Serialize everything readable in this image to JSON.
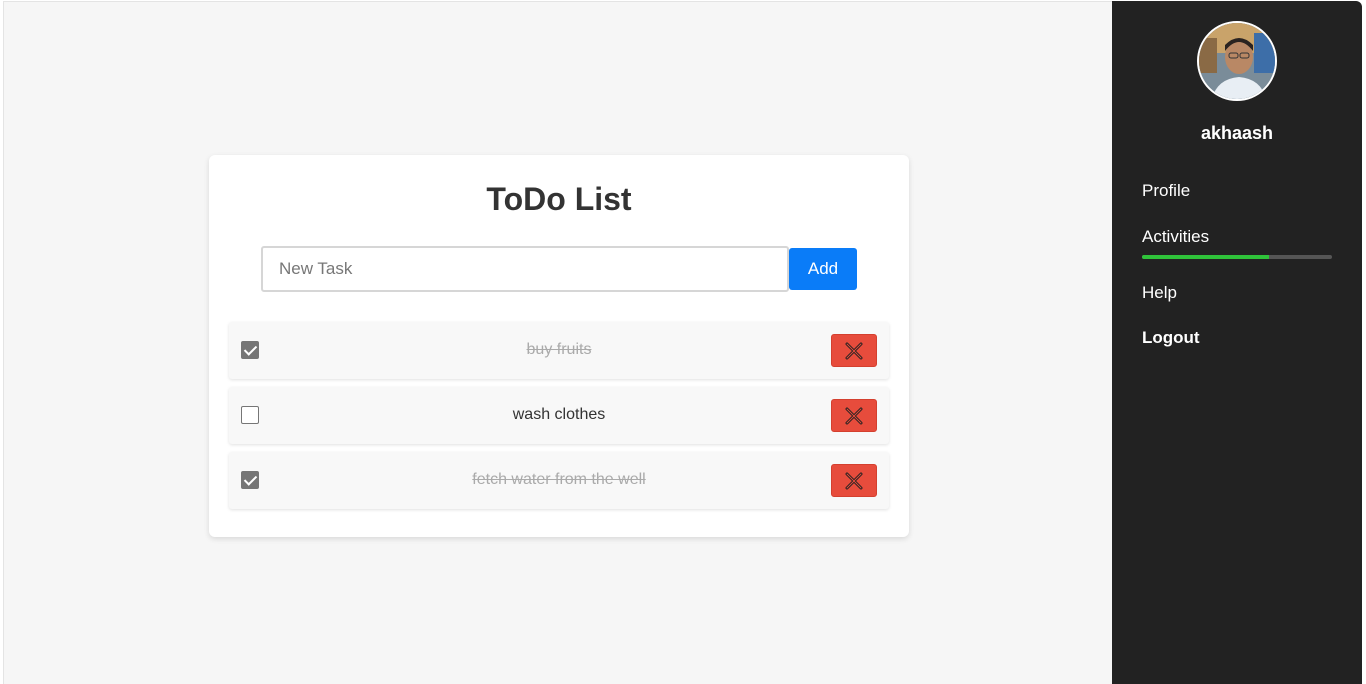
{
  "todo": {
    "title": "ToDo List",
    "input_placeholder": "New Task",
    "input_value": "",
    "add_label": "Add",
    "tasks": [
      {
        "text": "buy fruits",
        "done": true
      },
      {
        "text": "wash clothes",
        "done": false
      },
      {
        "text": "fetch water from the well",
        "done": true
      }
    ]
  },
  "sidebar": {
    "username": "akhaash",
    "nav": {
      "profile": "Profile",
      "activities": "Activities",
      "help": "Help",
      "logout": "Logout"
    },
    "activities_progress": 0.67
  },
  "colors": {
    "add_button": "#0a7cf8",
    "delete_button": "#e74c3c",
    "sidebar_bg": "#222222",
    "progress_fill": "#2fc33a"
  },
  "icons": {
    "delete": "close-icon"
  }
}
